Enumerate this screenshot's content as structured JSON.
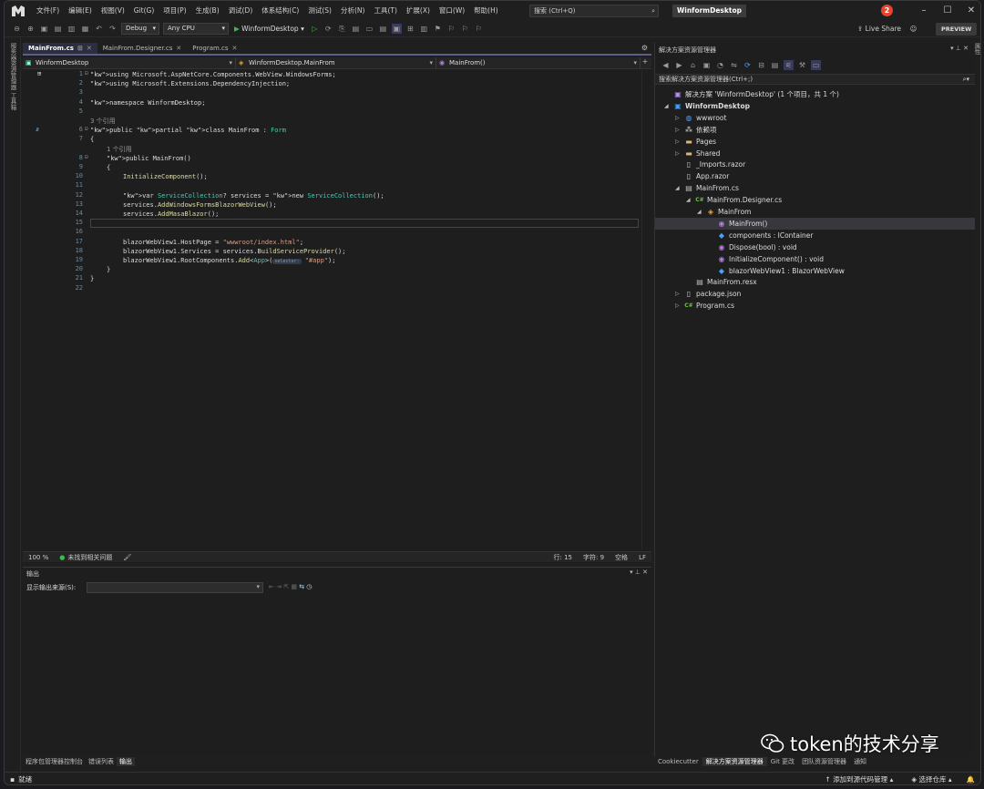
{
  "menu": [
    "文件(F)",
    "编辑(E)",
    "视图(V)",
    "Git(G)",
    "项目(P)",
    "生成(B)",
    "调试(D)",
    "体系结构(C)",
    "测试(S)",
    "分析(N)",
    "工具(T)",
    "扩展(X)",
    "窗口(W)",
    "帮助(H)"
  ],
  "search": {
    "placeholder": "搜索 (Ctrl+Q)"
  },
  "solution_title": "WinformDesktop",
  "notification_count": "2",
  "toolbar": {
    "config": "Debug",
    "platform": "Any CPU",
    "run_label": "WinformDesktop",
    "live_share": "Live Share",
    "preview": "PREVIEW"
  },
  "left_strip_label": "服务器资源管理器 工具箱",
  "right_strip_label": "属性",
  "editor": {
    "tabs": [
      {
        "label": "MainFrom.cs",
        "active": true
      },
      {
        "label": "MainFrom.Designer.cs",
        "active": false
      },
      {
        "label": "Program.cs",
        "active": false
      }
    ],
    "nav": {
      "project": "WinformDesktop",
      "class": "WinformDesktop.MainFrom",
      "member": "MainFrom()"
    },
    "lines": [
      {
        "n": "1",
        "t": "using Microsoft.AspNetCore.Components.WebView.WindowsForms;"
      },
      {
        "n": "2",
        "t": "using Microsoft.Extensions.DependencyInjection;"
      },
      {
        "n": "3",
        "t": ""
      },
      {
        "n": "4",
        "t": "namespace WinformDesktop;"
      },
      {
        "n": "5",
        "t": ""
      },
      {
        "n": "",
        "t": "3 个引用"
      },
      {
        "n": "6",
        "t": "public partial class MainFrom : Form"
      },
      {
        "n": "7",
        "t": "{"
      },
      {
        "n": "",
        "t": "1 个引用"
      },
      {
        "n": "8",
        "t": "public MainFrom()"
      },
      {
        "n": "9",
        "t": "{"
      },
      {
        "n": "10",
        "t": "InitializeComponent();"
      },
      {
        "n": "11",
        "t": ""
      },
      {
        "n": "12",
        "t": "var ServiceCollection? services = new ServiceCollection();"
      },
      {
        "n": "13",
        "t": "services.AddWindowsFormsBlazorWebView();"
      },
      {
        "n": "14",
        "t": "services.AddMasaBlazor();"
      },
      {
        "n": "15",
        "t": ""
      },
      {
        "n": "16",
        "t": ""
      },
      {
        "n": "17",
        "t": "blazorWebView1.HostPage = \"wwwroot/index.html\";"
      },
      {
        "n": "18",
        "t": "blazorWebView1.Services = services.BuildServiceProvider();"
      },
      {
        "n": "19",
        "t": "blazorWebView1.RootComponents.Add<App>(selector: \"#app\");"
      },
      {
        "n": "20",
        "t": "}"
      },
      {
        "n": "21",
        "t": "}"
      },
      {
        "n": "22",
        "t": ""
      }
    ],
    "status": {
      "zoom": "100 %",
      "issues": "未找到相关问题",
      "row": "行: 15",
      "col": "字符: 9",
      "space": "空格",
      "eol": "LF"
    }
  },
  "output": {
    "title": "输出",
    "source_label": "显示输出来源(S):",
    "bottom_tabs": [
      "程序包管理器控制台",
      "错误列表",
      "输出"
    ]
  },
  "solution_explorer": {
    "title": "解决方案资源管理器",
    "search": "搜索解决方案资源管理器(Ctrl+;)",
    "items": [
      {
        "label": "解决方案 'WinformDesktop' (1 个项目，共 1 个)",
        "icon": "solution-icon",
        "depth": 0,
        "bold": false
      },
      {
        "label": "WinformDesktop",
        "icon": "csharp-project-icon",
        "depth": 0,
        "bold": true
      },
      {
        "label": "wwwroot",
        "icon": "globe-icon",
        "depth": 1,
        "bold": false
      },
      {
        "label": "依赖项",
        "icon": "dependencies-icon",
        "depth": 1,
        "bold": false
      },
      {
        "label": "Pages",
        "icon": "folder-icon",
        "depth": 1,
        "bold": false
      },
      {
        "label": "Shared",
        "icon": "folder-icon",
        "depth": 1,
        "bold": false
      },
      {
        "label": "_Imports.razor",
        "icon": "razor-file-icon",
        "depth": 1,
        "bold": false
      },
      {
        "label": "App.razor",
        "icon": "razor-file-icon",
        "depth": 1,
        "bold": false
      },
      {
        "label": "MainFrom.cs",
        "icon": "form-icon",
        "depth": 1,
        "bold": false
      },
      {
        "label": "MainFrom.Designer.cs",
        "icon": "csharp-file-icon",
        "depth": 2,
        "bold": false
      },
      {
        "label": "MainFrom",
        "icon": "class-icon",
        "depth": 3,
        "bold": false
      },
      {
        "label": "MainFrom()",
        "icon": "method-icon",
        "depth": 4,
        "bold": false
      },
      {
        "label": "components : IContainer",
        "icon": "field-icon",
        "depth": 4,
        "bold": false
      },
      {
        "label": "Dispose(bool) : void",
        "icon": "method-icon",
        "depth": 4,
        "bold": false
      },
      {
        "label": "InitializeComponent() : void",
        "icon": "method-icon",
        "depth": 4,
        "bold": false
      },
      {
        "label": "blazorWebView1 : BlazorWebView",
        "icon": "field-icon",
        "depth": 4,
        "bold": false
      },
      {
        "label": "MainFrom.resx",
        "icon": "resx-file-icon",
        "depth": 2,
        "bold": false
      },
      {
        "label": "package.json",
        "icon": "json-file-icon",
        "depth": 1,
        "bold": false
      },
      {
        "label": "Program.cs",
        "icon": "csharp-file-icon",
        "depth": 1,
        "bold": false
      }
    ],
    "selected_index": 11,
    "bottom_tabs": [
      "Cookiecutter",
      "解决方案资源管理器",
      "Git 更改",
      "团队资源管理器",
      "通知"
    ]
  },
  "statusbar": {
    "ready": "就绪",
    "source_control": "添加到源代码管理",
    "repo": "选择仓库"
  },
  "watermark": "token的技术分享",
  "colors": {
    "keyword": "#569cd6",
    "type": "#4ec9b0",
    "string": "#d69d85",
    "method": "#dcdcaa"
  }
}
